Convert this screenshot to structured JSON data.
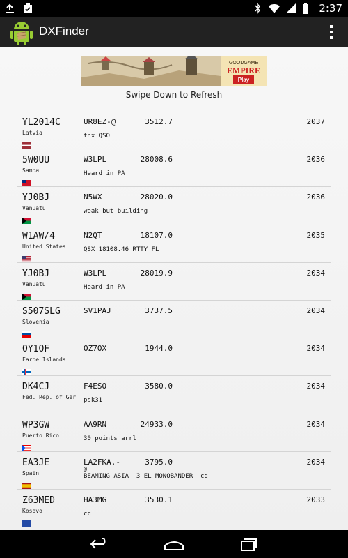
{
  "statusbar": {
    "clock": "2:37",
    "icons": [
      "upload-icon",
      "clipboard-icon",
      "bluetooth-icon",
      "wifi-icon",
      "signal-icon",
      "battery-icon"
    ]
  },
  "actionbar": {
    "title": "DXFinder",
    "app_icon": "android-icon",
    "overflow_icon": "overflow-menu-icon"
  },
  "ad": {
    "brand": "GOODGAME",
    "name": "EMPIRE",
    "cta": "Play"
  },
  "refresh_hint": "Swipe Down to Refresh",
  "spots": [
    {
      "dx": "YL2014C",
      "country": "Latvia",
      "flag": "latvia",
      "spotter": "UR8EZ-@",
      "freq": "3512.7",
      "time": "2037",
      "comment": "tnx QSO",
      "extra": ""
    },
    {
      "dx": "5W0UU",
      "country": "Samoa",
      "flag": "samoa",
      "spotter": "W3LPL",
      "freq": "28008.6",
      "time": "2036",
      "comment": "Heard in PA",
      "extra": ""
    },
    {
      "dx": "YJ0BJ",
      "country": "Vanuatu",
      "flag": "vanuatu",
      "spotter": "N5WX",
      "freq": "28020.0",
      "time": "2036",
      "comment": "weak but building",
      "extra": ""
    },
    {
      "dx": "W1AW/4",
      "country": "United States",
      "flag": "usa",
      "spotter": "N2QT",
      "freq": "18107.0",
      "time": "2035",
      "comment": "QSX 18108.46 RTTY FL",
      "extra": ""
    },
    {
      "dx": "YJ0BJ",
      "country": "Vanuatu",
      "flag": "vanuatu",
      "spotter": "W3LPL",
      "freq": "28019.9",
      "time": "2034",
      "comment": "Heard in PA",
      "extra": ""
    },
    {
      "dx": "S507SLG",
      "country": "Slovenia",
      "flag": "slovenia",
      "spotter": "SV1PAJ",
      "freq": "3737.5",
      "time": "2034",
      "comment": "",
      "extra": ""
    },
    {
      "dx": "OY1OF",
      "country": "Faroe Islands",
      "flag": "faroe",
      "spotter": "OZ7OX",
      "freq": "1944.0",
      "time": "2034",
      "comment": "",
      "extra": ""
    },
    {
      "dx": "DK4CJ",
      "country": "Fed. Rep. of Ger",
      "flag": "germany",
      "spotter": "F4ESO",
      "freq": "3580.0",
      "time": "2034",
      "comment": "psk31",
      "extra": ""
    },
    {
      "dx": "WP3GW",
      "country": "Puerto Rico",
      "flag": "puertorico",
      "spotter": "AA9RN",
      "freq": "24933.0",
      "time": "2034",
      "comment": "30 points arrl",
      "extra": ""
    },
    {
      "dx": "EA3JE",
      "country": "Spain",
      "flag": "spain",
      "spotter": "LA2FKA.-",
      "freq": "3795.0",
      "time": "2034",
      "comment": "BEAMING ASIA  3 EL MONOBANDER  cq",
      "extra": "@"
    },
    {
      "dx": "Z63MED",
      "country": "Kosovo",
      "flag": "kosovo",
      "spotter": "HA3MG",
      "freq": "3530.1",
      "time": "2033",
      "comment": "cc",
      "extra": ""
    }
  ],
  "navbar": {
    "back_icon": "back-icon",
    "home_icon": "home-icon",
    "recents_icon": "recents-icon"
  }
}
